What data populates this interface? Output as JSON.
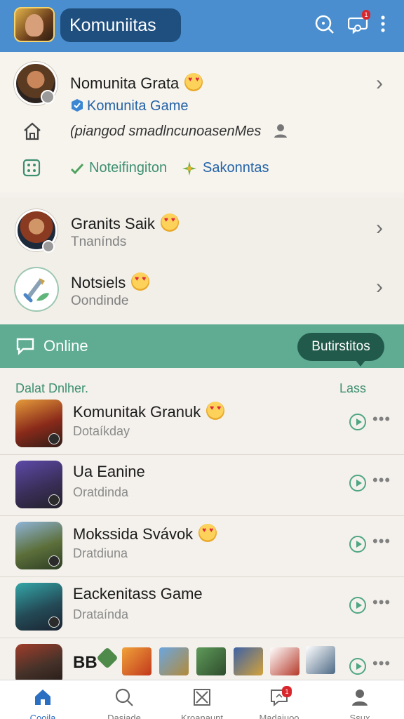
{
  "header": {
    "title": "Komuniitas",
    "notification_badge": "1",
    "colors": {
      "bar": "#4a8ed0",
      "title_pill": "#1f4f7e"
    }
  },
  "profile": {
    "name": "Nomunita Grata",
    "verified_label": "Komunita Game",
    "status_text": "(piangod smadlncunoasenMes",
    "notification_label": "Noteifingiton",
    "settings_label": "Sakonntas"
  },
  "contacts": [
    {
      "name": "Granits Saik",
      "sub": "Tnanínds"
    },
    {
      "name": "Notsiels",
      "sub": "Oondinde"
    }
  ],
  "online": {
    "label": "Online",
    "button": "Butirstitos",
    "list_title": "Dalat Dnlher.",
    "list_action": "Lass"
  },
  "games": [
    {
      "title": "Komunitak Granuk",
      "sub": "Dotaíkday",
      "has_emoji": true
    },
    {
      "title": "Ua Eanine",
      "sub": "Oratdinda",
      "has_emoji": false
    },
    {
      "title": "Mokssida Svávok",
      "sub": "Dratdiuna",
      "has_emoji": true
    },
    {
      "title": "Eackenitass Game",
      "sub": "Drataínda",
      "has_emoji": false
    },
    {
      "title": "BB",
      "sub": "",
      "has_emoji": false
    }
  ],
  "bottom_nav": [
    {
      "label": "Cooila",
      "icon": "home-icon",
      "active": true
    },
    {
      "label": "Dasiade",
      "icon": "search-icon",
      "active": false
    },
    {
      "label": "Kroanaunt",
      "icon": "close-box-icon",
      "active": false
    },
    {
      "label": "Madaiuoo",
      "icon": "messages-icon",
      "active": false,
      "badge": "1"
    },
    {
      "label": "Ssux",
      "icon": "profile-icon",
      "active": false
    }
  ]
}
